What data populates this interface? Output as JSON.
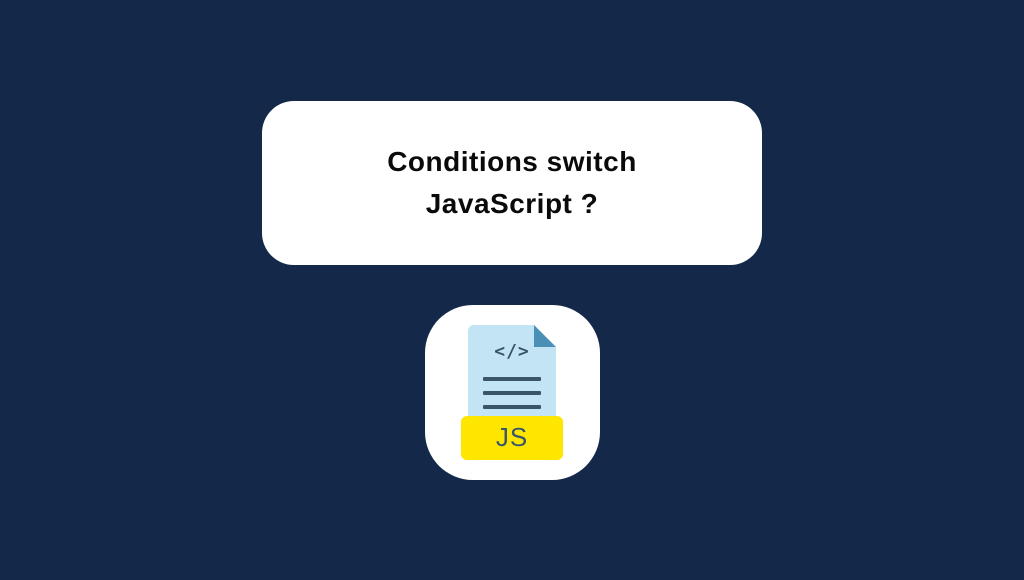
{
  "title": {
    "line1": "Conditions switch",
    "line2": "JavaScript ?"
  },
  "icon": {
    "code_symbol": "</>",
    "badge_text": "JS"
  }
}
